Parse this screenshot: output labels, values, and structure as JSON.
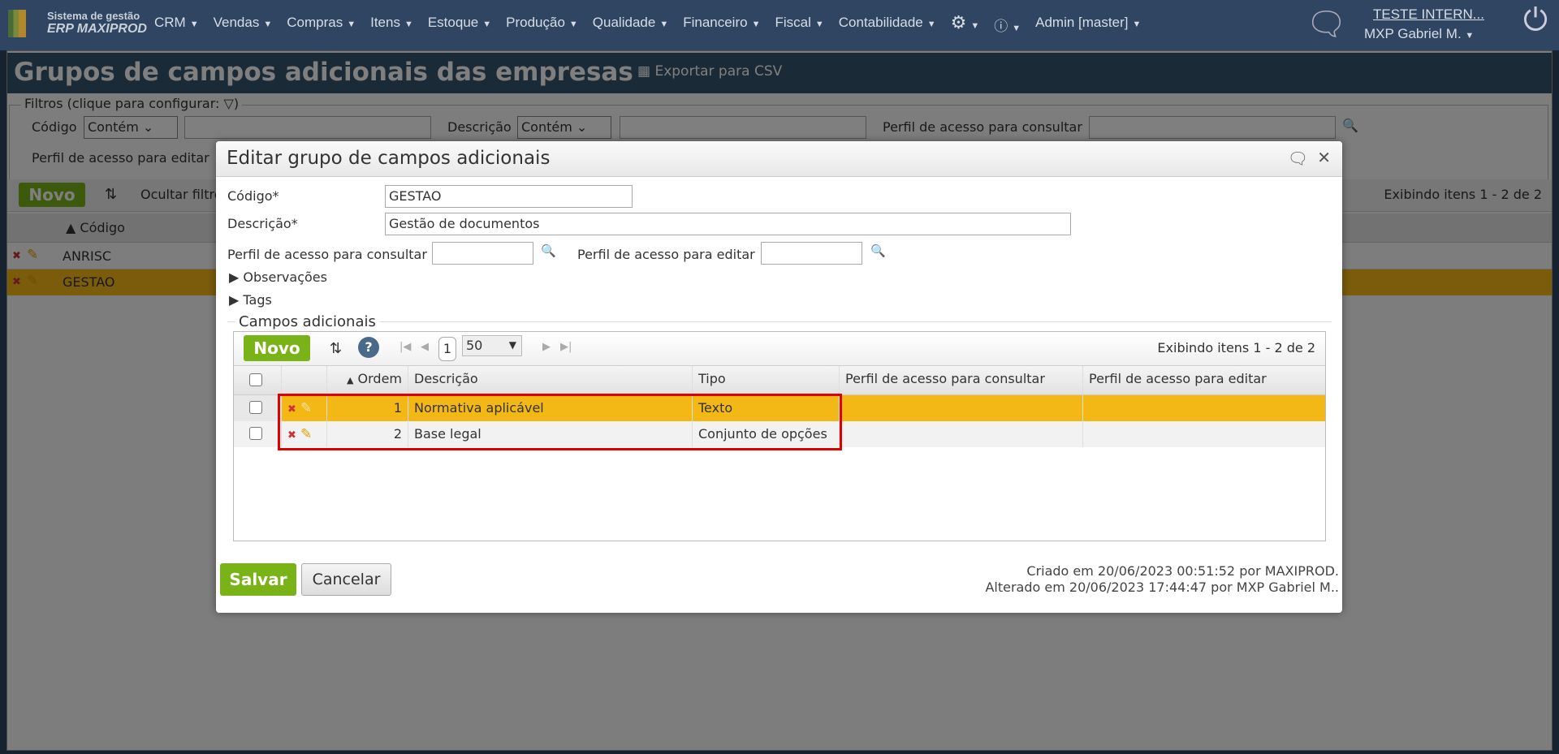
{
  "nav": {
    "brand_line1": "Sistema de gestão",
    "brand_line2": "ERP MAXIPROD",
    "menu": [
      "CRM",
      "Vendas",
      "Compras",
      "Itens",
      "Estoque",
      "Produção",
      "Qualidade",
      "Financeiro",
      "Fiscal",
      "Contabilidade"
    ],
    "admin": "Admin [master]",
    "company": "TESTE INTERN...",
    "user": "MXP Gabriel M."
  },
  "page": {
    "title": "Grupos de campos adicionais das empresas",
    "export": "Exportar para CSV",
    "filters": {
      "legend": "Filtros (clique para configurar:",
      "codigo": "Código",
      "codigo_op": "Contém",
      "descricao": "Descrição",
      "descricao_op": "Contém",
      "perfil_consultar": "Perfil de acesso para consultar",
      "perfil_editar": "Perfil de acesso para editar"
    },
    "toolbar": {
      "novo": "Novo",
      "hide_filters": "Ocultar filtros",
      "showing": "Exibindo itens 1 - 2 de 2"
    },
    "grid": {
      "col_codigo": "Código",
      "rows": [
        "ANRISC",
        "GESTAO"
      ]
    }
  },
  "dialog": {
    "title": "Editar grupo de campos adicionais",
    "codigo_label": "Código*",
    "codigo_value": "GESTAO",
    "descricao_label": "Descrição*",
    "descricao_value": "Gestão de documentos",
    "perfil_consultar": "Perfil de acesso para consultar",
    "perfil_editar": "Perfil de acesso para editar",
    "observacoes": "Observações",
    "tags": "Tags",
    "section": "Campos adicionais",
    "grid": {
      "novo": "Novo",
      "page": "1",
      "page_size": "50",
      "showing": "Exibindo itens 1 - 2 de 2",
      "columns": [
        "Ordem",
        "Descrição",
        "Tipo",
        "Perfil de acesso para consultar",
        "Perfil de acesso para editar"
      ],
      "rows": [
        {
          "ordem": "1",
          "descricao": "Normativa aplicável",
          "tipo": "Texto"
        },
        {
          "ordem": "2",
          "descricao": "Base legal",
          "tipo": "Conjunto de opções"
        }
      ]
    },
    "save": "Salvar",
    "cancel": "Cancelar",
    "created": "Criado em 20/06/2023 00:51:52 por MAXIPROD.",
    "modified": "Alterado em 20/06/2023 17:44:47 por MXP Gabriel M.."
  },
  "colors": {
    "nav": "#2f4562",
    "accent_green": "#7ab317",
    "selected_row": "#f4b816",
    "highlight": "#e00000"
  }
}
